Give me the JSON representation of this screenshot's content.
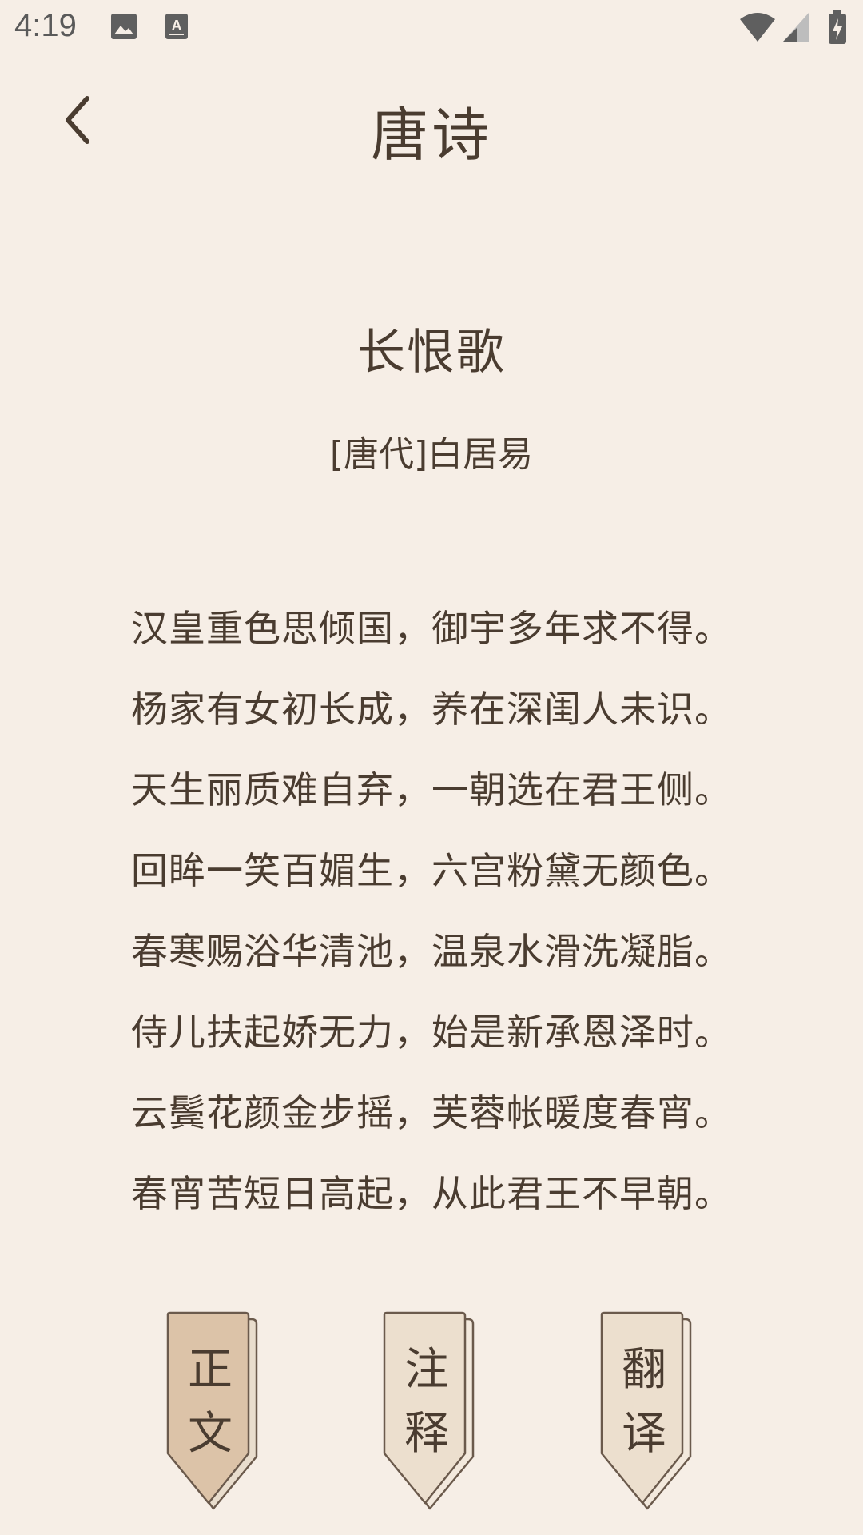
{
  "status_bar": {
    "time": "4:19",
    "icons": [
      "image-icon",
      "text-a-icon",
      "wifi-icon",
      "signal-icon",
      "battery-icon"
    ]
  },
  "nav": {
    "back_icon": "chevron-left-icon",
    "title": "唐诗"
  },
  "poem": {
    "title": "长恨歌",
    "author": "[唐代]白居易",
    "lines": [
      "汉皇重色思倾国，御宇多年求不得。",
      "杨家有女初长成，养在深闺人未识。",
      "天生丽质难自弃，一朝选在君王侧。",
      "回眸一笑百媚生，六宫粉黛无颜色。",
      "春寒赐浴华清池，温泉水滑洗凝脂。",
      "侍儿扶起娇无力，始是新承恩泽时。",
      "云鬓花颜金步摇，芙蓉帐暖度春宵。",
      "春宵苦短日高起，从此君王不早朝。"
    ]
  },
  "tabs": [
    {
      "char1": "正",
      "char2": "文",
      "active": true
    },
    {
      "char1": "注",
      "char2": "释",
      "active": false
    },
    {
      "char1": "翻",
      "char2": "译",
      "active": false
    }
  ],
  "colors": {
    "background": "#f6eee6",
    "text": "#4a3c30",
    "bookmark_active": "#dcc3a8",
    "bookmark_inactive": "#ecdfce",
    "bookmark_outline": "#6b5a4c"
  }
}
